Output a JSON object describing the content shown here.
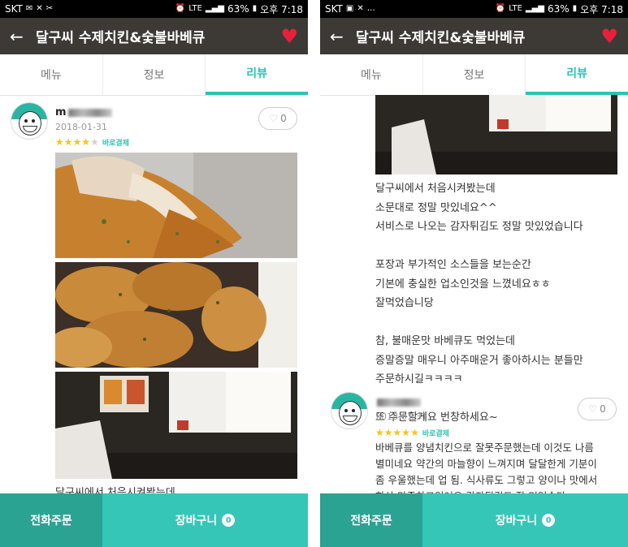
{
  "status_bar": {
    "carrier": "SKT",
    "battery": "63%",
    "time": "오후 7:18",
    "network": "LTE"
  },
  "app_bar": {
    "title": "달구씨 수제치킨&숯불바베큐"
  },
  "tabs": [
    {
      "label": "메뉴",
      "active": false
    },
    {
      "label": "정보",
      "active": false
    },
    {
      "label": "리뷰",
      "active": true
    }
  ],
  "reviews": [
    {
      "user": "m",
      "date": "2018-01-31",
      "stars": 4,
      "badge": "바로결제",
      "likes": "0",
      "text_preview": "달구씨에서 처음시켜봤는데",
      "text": "달구씨에서 처음시켜봤는데\n소문대로 정말 맛있네요^^\n서비스로 나오는 감자튀김도 정말 맛있었습니다\n\n포장과 부가적인 소스들을 보는순간\n기본에 충실한 업소인것을 느꼈네요ㅎㅎ\n잘먹었습니당\n\n참, 불매운맛 바베큐도 먹었는데\n증말증말 매우니 아주매운거 좋아하시는 분들만\n주문하시길ㅋㅋㅋㅋ\n\n또 주문할게요 번창하세요~"
    },
    {
      "user": "",
      "date": "2018-01-31",
      "stars": 5,
      "badge": "바로결제",
      "likes": "0",
      "text": "바베큐를 양념치킨으로 잘못주문했는데 이것도 나름\n별미네요 약간의 마늘향이 느껴지며 달달한게 기분이\n좀 우울했는데 업 됨. 식사류도 그렇고 양이나 맛에서\n한상 만족하고있어요 감자튀김도 잘 먹었습다~"
    }
  ],
  "bottom_bar": {
    "phone_order": "전화주문",
    "cart": "장바구니",
    "cart_count": "0"
  },
  "colors": {
    "accent": "#2fc2b6",
    "appbar": "#3d3a36",
    "heart": "#e8203a",
    "bottom_dark": "#2aa393",
    "bottom_light": "#35c6b8"
  }
}
